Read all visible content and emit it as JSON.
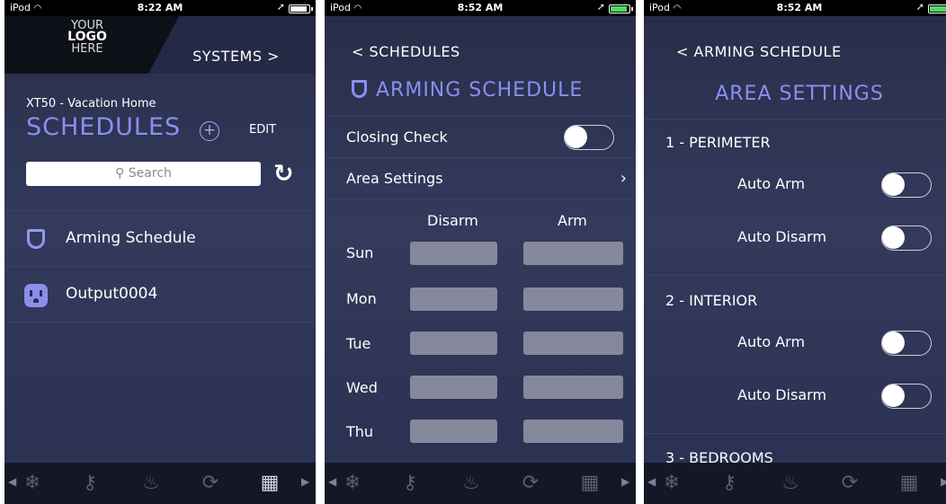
{
  "panel1": {
    "status": {
      "carrier": "iPod",
      "time": "8:22 AM"
    },
    "logo": {
      "line1": "YOUR",
      "line2": "LOGO",
      "line3": "HERE"
    },
    "systems_link": "SYSTEMS >",
    "subtitle": "XT50 - Vacation Home",
    "title": "SCHEDULES",
    "edit_label": "EDIT",
    "search_placeholder": "Search",
    "list": [
      {
        "label": "Arming Schedule",
        "icon": "shield-icon"
      },
      {
        "label": "Output0004",
        "icon": "outlet-icon"
      }
    ]
  },
  "panel2": {
    "status": {
      "carrier": "iPod",
      "time": "8:52 AM"
    },
    "back_label": "SCHEDULES",
    "title": "ARMING SCHEDULE",
    "closing_check_label": "Closing Check",
    "closing_check_on": false,
    "area_settings_label": "Area Settings",
    "columns": {
      "disarm": "Disarm",
      "arm": "Arm"
    },
    "days": [
      "Sun",
      "Mon",
      "Tue",
      "Wed",
      "Thu"
    ]
  },
  "panel3": {
    "status": {
      "carrier": "iPod",
      "time": "8:52 AM"
    },
    "back_label": "ARMING SCHEDULE",
    "title": "AREA SETTINGS",
    "areas": [
      {
        "name": "1 - PERIMETER",
        "auto_arm_label": "Auto Arm",
        "auto_disarm_label": "Auto Disarm",
        "auto_arm_on": false,
        "auto_disarm_on": false
      },
      {
        "name": "2 - INTERIOR",
        "auto_arm_label": "Auto Arm",
        "auto_disarm_label": "Auto Disarm",
        "auto_arm_on": false,
        "auto_disarm_on": false
      },
      {
        "name": "3 - BEDROOMS"
      }
    ]
  },
  "tabbar": {
    "tabs": [
      "zwave-icon",
      "key-icon",
      "lightbulb-icon",
      "power-icon",
      "calendar-icon"
    ],
    "active_tab": "calendar-icon"
  },
  "colors": {
    "accent": "#8a8ff2",
    "background": "#2f3556",
    "tabbar": "#141726",
    "battery_green": "#4cd964"
  }
}
